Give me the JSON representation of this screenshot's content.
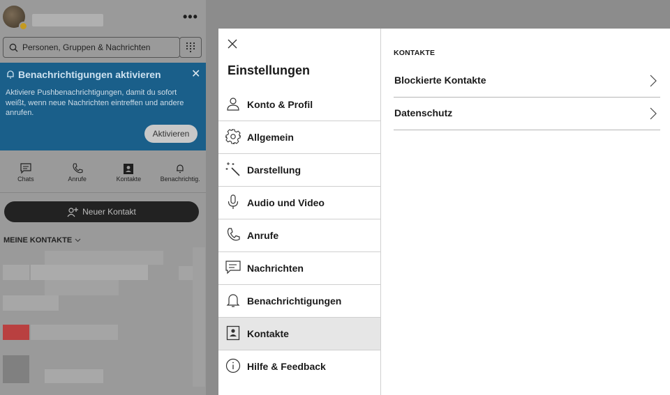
{
  "left_pane": {
    "search": {
      "placeholder": "Personen, Gruppen & Nachrichten"
    },
    "notification": {
      "title": "Benachrichtigungen aktivieren",
      "text": "Aktiviere Pushbenachrichtigungen, damit du sofort weißt, wenn neue Nachrichten eintreffen und andere anrufen.",
      "button": "Aktivieren",
      "close": "✕"
    },
    "tabs": [
      {
        "label": "Chats",
        "icon": "chat-icon"
      },
      {
        "label": "Anrufe",
        "icon": "phone-icon"
      },
      {
        "label": "Kontakte",
        "icon": "contacts-icon"
      },
      {
        "label": "Benachrichtig.",
        "icon": "bell-icon"
      }
    ],
    "new_contact": "Neuer Kontakt",
    "my_contacts": "MEINE KONTAKTE",
    "more": "•••"
  },
  "settings": {
    "title": "Einstellungen",
    "nav": [
      {
        "label": "Konto & Profil",
        "icon": "person-icon"
      },
      {
        "label": "Allgemein",
        "icon": "gear-icon"
      },
      {
        "label": "Darstellung",
        "icon": "magic-wand-icon"
      },
      {
        "label": "Audio und Video",
        "icon": "microphone-icon"
      },
      {
        "label": "Anrufe",
        "icon": "phone-icon"
      },
      {
        "label": "Nachrichten",
        "icon": "message-icon"
      },
      {
        "label": "Benachrichtigungen",
        "icon": "bell-icon"
      },
      {
        "label": "Kontakte",
        "icon": "contacts-icon",
        "active": true
      },
      {
        "label": "Hilfe & Feedback",
        "icon": "info-icon"
      }
    ],
    "section_title": "KONTAKTE",
    "rows": [
      {
        "label": "Blockierte Kontakte"
      },
      {
        "label": "Datenschutz"
      }
    ]
  },
  "colors": {
    "notification_bg": "#1a5f8a",
    "overlay": "#9a9a9a",
    "active_nav": "#e6e6e6"
  }
}
